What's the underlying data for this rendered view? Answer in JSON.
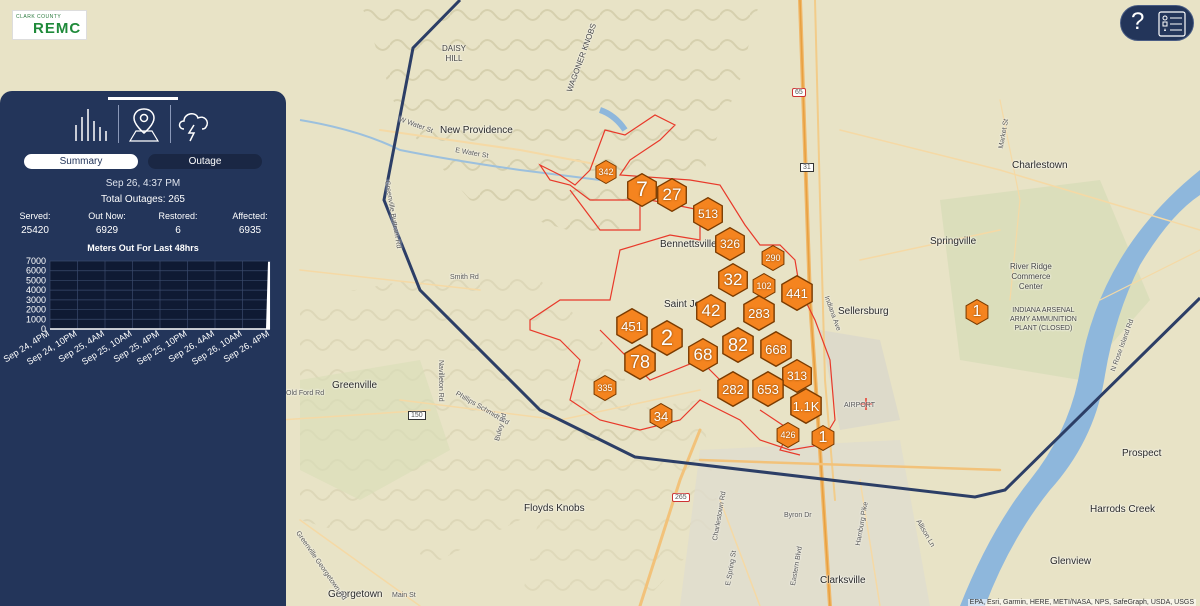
{
  "logo": {
    "small_text": "CLARK COUNTY",
    "name": "REMC"
  },
  "panel": {
    "tabs": [
      {
        "name": "summary-chart",
        "icon": "bar-chart-icon"
      },
      {
        "name": "map",
        "icon": "map-pin-icon"
      },
      {
        "name": "weather",
        "icon": "storm-cloud-icon"
      }
    ],
    "toggle": {
      "summary_label": "Summary",
      "outage_label": "Outage"
    },
    "timestamp": "Sep 26, 4:37 PM",
    "total_outages": "Total Outages: 265",
    "stats": [
      {
        "label": "Served:",
        "value": "25420"
      },
      {
        "label": "Out Now:",
        "value": "6929"
      },
      {
        "label": "Restored:",
        "value": "6"
      },
      {
        "label": "Affected:",
        "value": "6935"
      }
    ]
  },
  "chart_data": {
    "type": "area",
    "title": "Meters Out For Last 48hrs",
    "categories": [
      "Sep 24, 4PM",
      "Sep 24, 10PM",
      "Sep 25, 4AM",
      "Sep 25, 10AM",
      "Sep 25, 4PM",
      "Sep 25, 10PM",
      "Sep 26, 4AM",
      "Sep 26, 10AM",
      "Sep 26, 4PM"
    ],
    "values": [
      0,
      0,
      0,
      0,
      0,
      0,
      0,
      0,
      6929
    ],
    "yticks": [
      "7000",
      "6000",
      "5000",
      "4000",
      "3000",
      "2000",
      "1000",
      "0"
    ],
    "ylim": [
      0,
      7000
    ],
    "grid": true,
    "colors": {
      "fill": "#ffffff",
      "grid": "#1a2744",
      "bg": "#23355a"
    }
  },
  "map": {
    "places": [
      {
        "name": "New Providence"
      },
      {
        "name": "DAISY\nHILL"
      },
      {
        "name": "WAGONER KNOBS"
      },
      {
        "name": "Charlestown"
      },
      {
        "name": "Bennettsville"
      },
      {
        "name": "Springville"
      },
      {
        "name": "Saint Joe"
      },
      {
        "name": "Sellersburg"
      },
      {
        "name": "River Ridge\nCommerce\nCenter"
      },
      {
        "name": "INDIANA ARSENAL\nARMY AMMUNITION\nPLANT (CLOSED)"
      },
      {
        "name": "Greenville"
      },
      {
        "name": "Prospect"
      },
      {
        "name": "Floyds Knobs"
      },
      {
        "name": "Harrods Creek"
      },
      {
        "name": "Glenview"
      },
      {
        "name": "Clarksville"
      },
      {
        "name": "Georgetown"
      },
      {
        "name": "AIRPORT"
      }
    ],
    "roads": [
      "W Water St",
      "E Water St",
      "Greenville Buttram Rd",
      "Smith Rd",
      "Navilleton Rd",
      "Phillips Schmidt Rd",
      "Buley Rd",
      "Charlestown Rd",
      "Byron Dr",
      "Hamburg Pike",
      "Allison Ln",
      "Main St",
      "Greenville Georgetown Rd",
      "N Rose Island Rd",
      "Market St",
      "Indiana Ave",
      "E Spring St",
      "Eastern Blvd",
      "Old Ford Rd"
    ],
    "shields": [
      "65",
      "31",
      "265",
      "150",
      "60"
    ],
    "clusters": [
      "342",
      "7",
      "27",
      "513",
      "326",
      "290",
      "32",
      "102",
      "441",
      "42",
      "283",
      "451",
      "2",
      "82",
      "668",
      "78",
      "68",
      "313",
      "335",
      "282",
      "653",
      "1.1K",
      "34",
      "426",
      "1",
      "1"
    ],
    "accent_color": "#f5841f",
    "boundary_color": "#2c3e66",
    "outage_area_color": "#e8392a"
  },
  "attribution": "EPA, Esri, Garmin, HERE, METI/NASA, NPS, SafeGraph, USDA, USGS",
  "help_label": "?"
}
